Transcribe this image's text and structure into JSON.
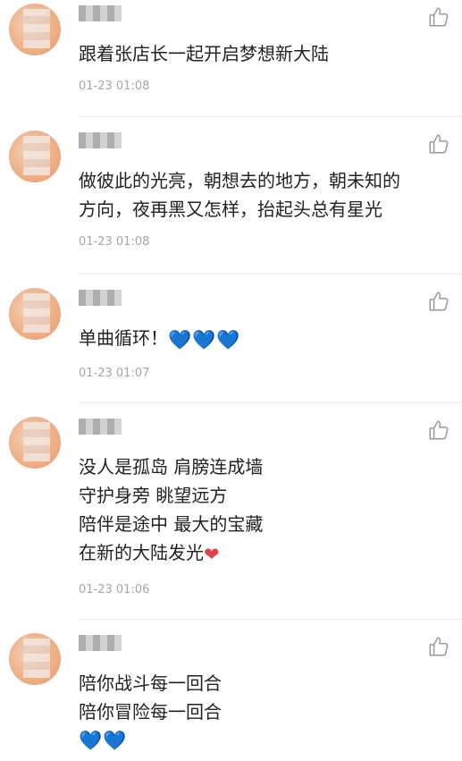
{
  "colors": {
    "text": "#222222",
    "time": "#a6a6a6",
    "blue_heart": "#56a7f2",
    "red_heart": "#e0424b"
  },
  "comments": [
    {
      "username": "用户",
      "lines": [
        "跟着张店长一起开启梦想新大陆"
      ],
      "time": "01-23 01:08"
    },
    {
      "username": "用户",
      "lines": [
        "做彼此的光亮，朝想去的地方，朝未知的",
        "方向，夜再黑又怎样，抬起头总有星光"
      ],
      "time": "01-23 01:08"
    },
    {
      "username": "用户",
      "lines": [
        "单曲循环！"
      ],
      "hearts": "💙💙💙",
      "time": "01-23 01:07"
    },
    {
      "username": "用户",
      "lines": [
        "没人是孤岛 肩膀连成墙",
        "守护身旁 眺望远方",
        "陪伴是途中 最大的宝藏",
        "在新的大陆发光"
      ],
      "hearts": "❤",
      "time": "01-23 01:06"
    },
    {
      "username": "用户",
      "lines": [
        "陪你战斗每一回合",
        "陪你冒险每一回合"
      ],
      "hearts": "💙💙"
    }
  ],
  "icons": {
    "like": "thumbs-up-icon",
    "avatar": "blurred-avatar"
  }
}
